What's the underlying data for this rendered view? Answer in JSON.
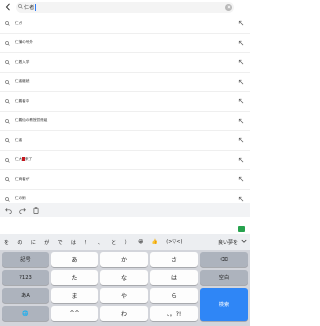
{
  "search": {
    "query": "仁者",
    "icons": {
      "back": "chevron-left-icon",
      "search": "magnifier-icon",
      "clear": "clear-circle-icon"
    }
  },
  "suggestions": [
    {
      "prefix": "仁ガ",
      "hl": "",
      "suffix": ""
    },
    {
      "prefix": "仁蒲の号外",
      "hl": "",
      "suffix": ""
    },
    {
      "prefix": "仁着入学",
      "hl": "",
      "suffix": ""
    },
    {
      "prefix": "仁者継続",
      "hl": "",
      "suffix": ""
    },
    {
      "prefix": "仁義者中",
      "hl": "",
      "suffix": ""
    },
    {
      "prefix": "仁義仙の教授賞賛組",
      "hl": "",
      "suffix": ""
    },
    {
      "prefix": "仁者",
      "hl": "",
      "suffix": ""
    },
    {
      "prefix": "仁大",
      "hl": "▇",
      "suffix": "来了"
    },
    {
      "prefix": "仁両者が",
      "hl": "",
      "suffix": ""
    },
    {
      "prefix": "仁の術",
      "hl": "",
      "suffix": ""
    }
  ],
  "toolbar": {
    "undo_icon": "undo-icon",
    "redo_icon": "redo-icon",
    "clipboard_icon": "clipboard-icon"
  },
  "candidates": [
    "を",
    "の",
    "に",
    "が",
    "で",
    "は",
    "！",
    "、",
    "と",
    "）",
    "😀",
    "👍",
    "(>▽<)"
  ],
  "candidate_last": "良い夢を",
  "keyboard": {
    "rows": [
      [
        "記号",
        "あ",
        "か",
        "さ",
        "⌫"
      ],
      [
        "?123",
        "た",
        "な",
        "は",
        "空白"
      ],
      [
        "あA",
        "ま",
        "や",
        "ら",
        "検索"
      ],
      [
        "🌐",
        "^^",
        "わ",
        "、。?!",
        ""
      ]
    ]
  }
}
